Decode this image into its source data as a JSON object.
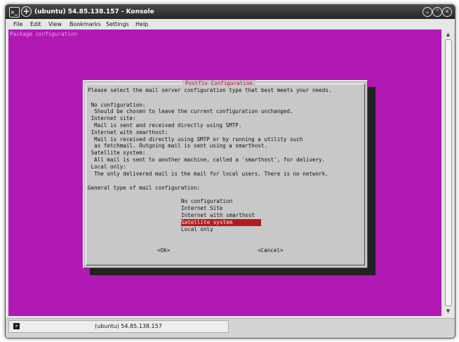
{
  "window": {
    "title": "(ubuntu) 54.85.138.157 - Konsole",
    "minimize_glyph": "⌄",
    "maximize_glyph": "⌃",
    "close_glyph": "✕"
  },
  "menu": {
    "file": "File",
    "edit": "Edit",
    "view": "View",
    "bookmarks": "Bookmarks",
    "settings": "Settings",
    "help": "Help"
  },
  "terminal": {
    "package_title": "Package configuration",
    "dialog": {
      "title": "Postfix Configuration",
      "lines": [
        "Please select the mail server configuration type that best meets your needs.",
        " No configuration:",
        "  Should be chosen to leave the current configuration unchanged.",
        " Internet site:",
        "  Mail is sent and received directly using SMTP.",
        " Internet with smarthost:",
        "  Mail is received directly using SMTP or by running a utility such",
        "  as fetchmail. Outgoing mail is sent using a smarthost.",
        " Satellite system:",
        "  All mail is sent to another machine, called a 'smarthost', for delivery.",
        " Local only:",
        "  The only delivered mail is the mail for local users. There is no network.",
        "General type of mail configuration:"
      ],
      "options": [
        "No configuration",
        "Internet Site",
        "Internet with smarthost",
        "Satellite system",
        "Local only"
      ],
      "selected_option": "Satellite system",
      "ok_label": "<Ok>",
      "cancel_label": "<Cancel>"
    }
  },
  "tab": {
    "label": "(ubuntu) 54.85.138.157"
  },
  "colors": {
    "terminal_background": "#b019b4",
    "dialog_background": "#c8c8c8",
    "selection": "#b11b1b",
    "dialog_title": "#b02020"
  },
  "icons": {
    "app": "konsole-terminal-icon",
    "new_tab": "plus-circle-icon",
    "minimize": "chevron-down-circle-icon",
    "maximize": "chevron-up-circle-icon",
    "close": "close-circle-icon",
    "scroll_up": "arrow-up-icon",
    "scroll_down": "arrow-down-icon",
    "tab": "terminal-icon"
  }
}
